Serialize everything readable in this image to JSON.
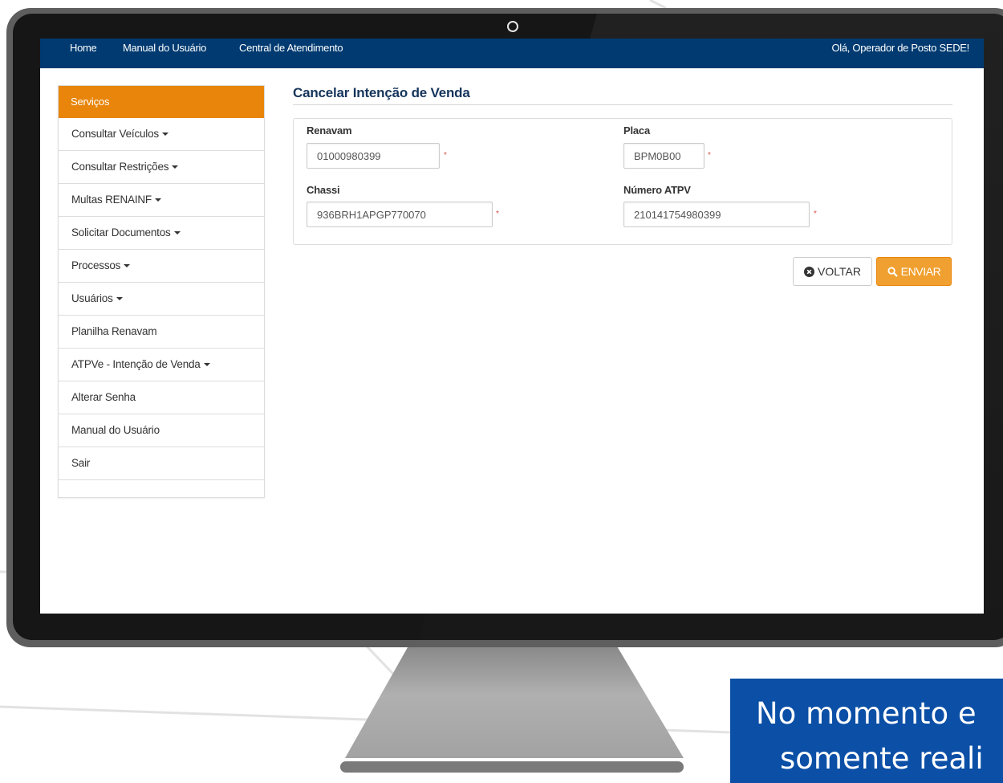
{
  "topnav": {
    "links": [
      "Home",
      "Manual do Usuário",
      "Central de Atendimento"
    ],
    "greeting": "Olá, Operador de Posto SEDE!"
  },
  "sidebar": {
    "header": "Serviços",
    "items": [
      {
        "label": "Consultar Veículos",
        "has_dropdown": true
      },
      {
        "label": "Consultar Restrições",
        "has_dropdown": true
      },
      {
        "label": "Multas RENAINF",
        "has_dropdown": true
      },
      {
        "label": "Solicitar Documentos",
        "has_dropdown": true
      },
      {
        "label": "Processos",
        "has_dropdown": true
      },
      {
        "label": "Usuários",
        "has_dropdown": true
      },
      {
        "label": "Planilha Renavam",
        "has_dropdown": false
      },
      {
        "label": "ATPVe - Intenção de Venda",
        "has_dropdown": true
      },
      {
        "label": "Alterar Senha",
        "has_dropdown": false
      },
      {
        "label": "Manual do Usuário",
        "has_dropdown": false
      },
      {
        "label": "Sair",
        "has_dropdown": false
      }
    ]
  },
  "page": {
    "title": "Cancelar Intenção de Venda"
  },
  "form": {
    "renavam": {
      "label": "Renavam",
      "value": "01000980399"
    },
    "placa": {
      "label": "Placa",
      "value": "BPM0B00"
    },
    "chassi": {
      "label": "Chassi",
      "value": "936BRH1APGP770070"
    },
    "numero_atpv": {
      "label": "Número ATPV",
      "value": "210141754980399"
    },
    "required_mark": "*"
  },
  "actions": {
    "voltar_label": "VOLTAR",
    "enviar_label": "ENVIAR"
  },
  "caption": {
    "line1": "No momento e",
    "line2": "somente reali"
  },
  "colors": {
    "nav_bg": "#003a70",
    "accent_orange": "#e8850a",
    "caption_bg": "#0b4fa6",
    "title_text": "#16355c"
  },
  "icons": {
    "voltar": "circle-x-icon",
    "enviar": "search-icon"
  }
}
